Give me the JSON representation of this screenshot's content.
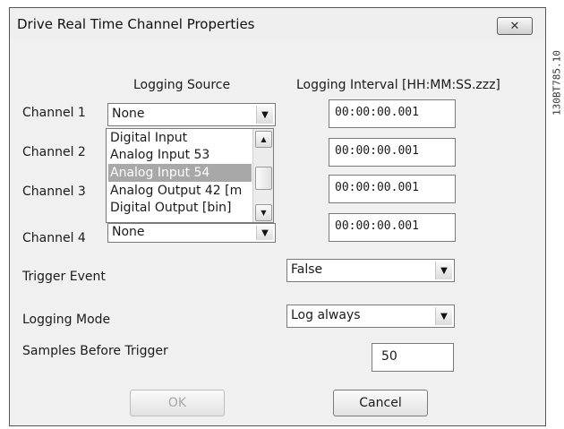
{
  "window": {
    "title": "Drive Real Time Channel Properties"
  },
  "figure_code": "130BT785.10",
  "headers": {
    "logging_source": "Logging Source",
    "logging_interval": "Logging Interval [HH:MM:SS.zzz]"
  },
  "channels": [
    {
      "label": "Channel 1",
      "source": "None",
      "interval": "00:00:00.001"
    },
    {
      "label": "Channel 2",
      "interval": "00:00:00.001"
    },
    {
      "label": "Channel 3",
      "interval": "00:00:00.001"
    },
    {
      "label": "Channel 4",
      "source": "None",
      "interval": "00:00:00.001"
    }
  ],
  "dropdown_list": {
    "options": [
      "Digital Input",
      "Analog Input 53",
      "Analog Input 54",
      "Analog Output 42 [m",
      "Digital Output [bin]"
    ],
    "selected": "Analog Input 54"
  },
  "trigger_event": {
    "label": "Trigger Event",
    "value": "False"
  },
  "logging_mode": {
    "label": "Logging Mode",
    "value": "Log always"
  },
  "samples_before_trigger": {
    "label": "Samples Before Trigger",
    "value": "50"
  },
  "buttons": {
    "ok": "OK",
    "cancel": "Cancel"
  }
}
